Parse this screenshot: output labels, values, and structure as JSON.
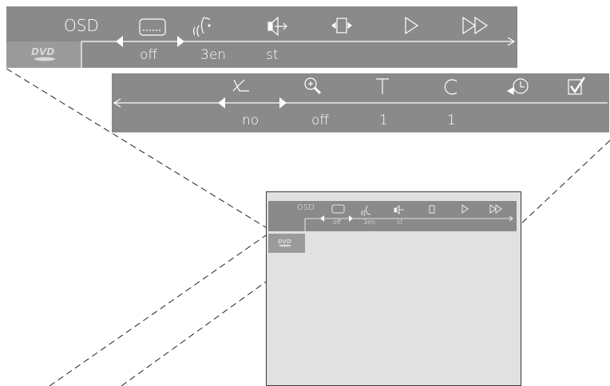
{
  "colors": {
    "bar": "#8a8a8a",
    "screen": "#e1e1e1",
    "ink": "#ffffff",
    "guide": "#222222"
  },
  "top_menu": {
    "osd_label": "OSD",
    "dvd_logo": "DVD",
    "icons": [
      "subtitle-icon",
      "audio-language-icon",
      "sound-mode-icon",
      "angle-icon",
      "play-icon",
      "fast-forward-icon"
    ],
    "values": {
      "subtitle": "off",
      "audio": "3en",
      "sound": "st"
    }
  },
  "second_menu": {
    "icons": [
      "angle-off-icon",
      "zoom-icon",
      "title-icon",
      "chapter-icon",
      "time-search-icon",
      "check-icon"
    ],
    "values": {
      "angle": "no",
      "zoom": "off",
      "title": "1",
      "chapter": "1"
    }
  },
  "preview": {
    "osd_label": "OSD",
    "dvd_logo": "DVD",
    "values": {
      "subtitle": "off",
      "audio": "3en",
      "sound": "st"
    }
  }
}
